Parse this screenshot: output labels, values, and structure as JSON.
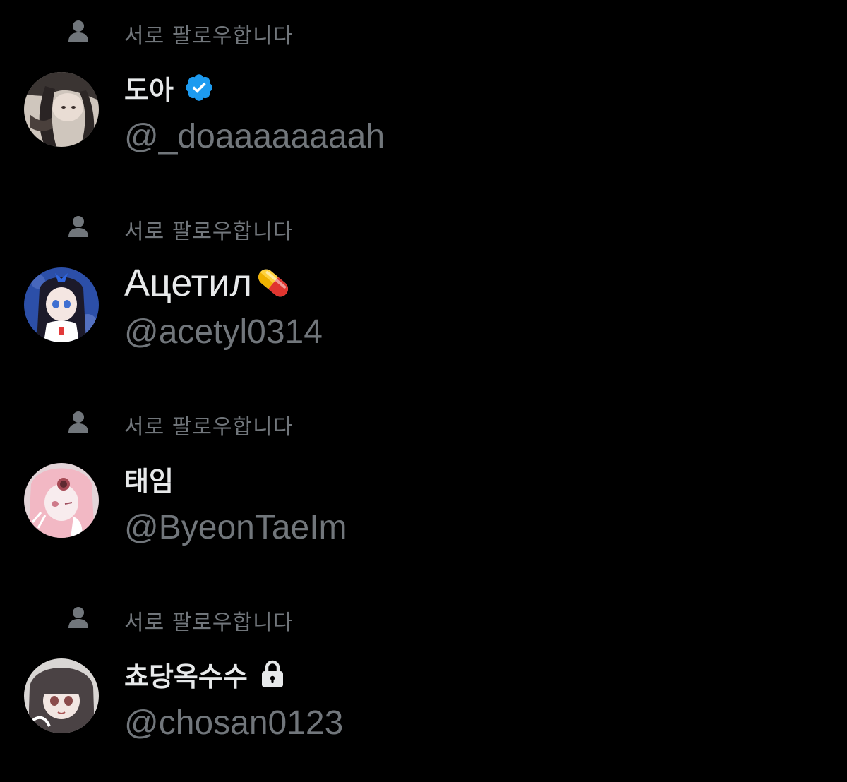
{
  "colors": {
    "background": "#000000",
    "primary_text": "#e7e9ea",
    "secondary_text": "#71767b",
    "verified_blue": "#1d9bf0"
  },
  "users": [
    {
      "mutual_label": "서로 팔로우합니다",
      "mutual_icon": "person-icon",
      "display_name": "도아",
      "handle": "@_doaaaaaaaah",
      "badge": "verified-badge-icon"
    },
    {
      "mutual_label": "서로 팔로우합니다",
      "mutual_icon": "person-icon",
      "display_name": "Ацетил",
      "handle": "@acetyl0314",
      "badge": "pill-emoji-icon"
    },
    {
      "mutual_label": "서로 팔로우합니다",
      "mutual_icon": "person-icon",
      "display_name": "태임",
      "handle": "@ByeonTaeIm",
      "badge": ""
    },
    {
      "mutual_label": "서로 팔로우합니다",
      "mutual_icon": "person-icon",
      "display_name": "쵸당옥수수",
      "handle": "@chosan0123",
      "badge": "lock-icon"
    }
  ]
}
